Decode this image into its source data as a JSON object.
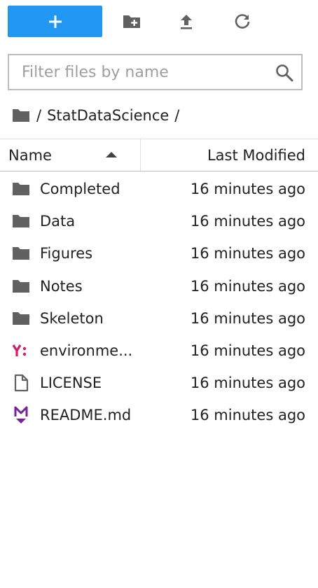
{
  "toolbar": {
    "new_label": "+",
    "icons": [
      "new-folder-icon",
      "upload-icon",
      "refresh-icon"
    ],
    "accent_color": "#2196f3"
  },
  "filter": {
    "placeholder": "Filter files by name",
    "value": ""
  },
  "breadcrumb": {
    "root_sep": "/",
    "folder": "StatDataScience",
    "trail_sep": "/"
  },
  "header": {
    "name_label": "Name",
    "modified_label": "Last Modified",
    "sort": "ascending"
  },
  "files": [
    {
      "name": "Completed",
      "modified": "16 minutes ago",
      "icon": "folder-icon"
    },
    {
      "name": "Data",
      "modified": "16 minutes ago",
      "icon": "folder-icon"
    },
    {
      "name": "Figures",
      "modified": "16 minutes ago",
      "icon": "folder-icon"
    },
    {
      "name": "Notes",
      "modified": "16 minutes ago",
      "icon": "folder-icon"
    },
    {
      "name": "Skeleton",
      "modified": "16 minutes ago",
      "icon": "folder-icon"
    },
    {
      "name": "environme...",
      "modified": "16 minutes ago",
      "icon": "yaml-icon"
    },
    {
      "name": "LICENSE",
      "modified": "16 minutes ago",
      "icon": "file-icon"
    },
    {
      "name": "README.md",
      "modified": "16 minutes ago",
      "icon": "markdown-icon"
    }
  ]
}
